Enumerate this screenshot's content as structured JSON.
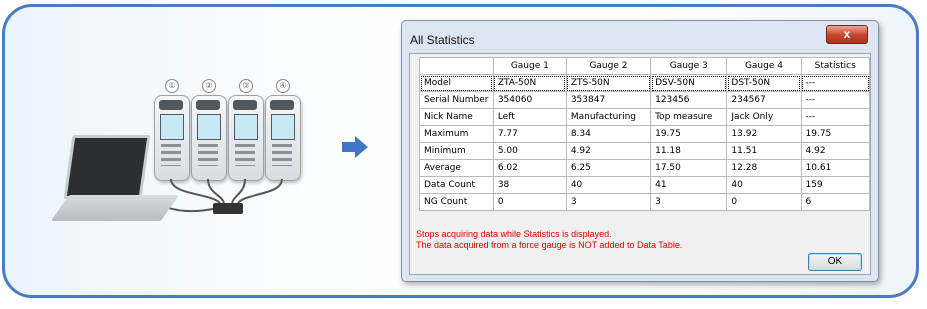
{
  "illustration": {
    "gauge_numbers": [
      "①",
      "②",
      "③",
      "④"
    ]
  },
  "dialog": {
    "title": "All Statistics",
    "close_label": "x",
    "table": {
      "headers": [
        "",
        "Gauge 1",
        "Gauge 2",
        "Gauge 3",
        "Gauge 4",
        "Statistics"
      ],
      "rows": [
        [
          "Model",
          "ZTA-50N",
          "ZTS-50N",
          "DSV-50N",
          "DST-50N",
          "---"
        ],
        [
          "Serial Number",
          "354060",
          "353847",
          "123456",
          "234567",
          "---"
        ],
        [
          "Nick Name",
          "Left",
          "Manufacturing",
          "Top measure",
          "Jack Only",
          "---"
        ],
        [
          "Maximum",
          "7.77",
          "8.34",
          "19.75",
          "13.92",
          "19.75"
        ],
        [
          "Minimum",
          "5.00",
          "4.92",
          "11.18",
          "11.51",
          "4.92"
        ],
        [
          "Average",
          "6.02",
          "6.25",
          "17.50",
          "12.28",
          "10.61"
        ],
        [
          "Data Count",
          "38",
          "40",
          "41",
          "40",
          "159"
        ],
        [
          "NG Count",
          "0",
          "3",
          "3",
          "0",
          "6"
        ]
      ]
    },
    "note_line1": "Stops acquiring data while Statistics is displayed.",
    "note_line2": "The data acquired from a force gauge is NOT added to Data Table.",
    "ok_label": "OK"
  },
  "colors": {
    "frame_border": "#4a7cc2",
    "arrow": "#3d78c4",
    "note_text": "#e00000"
  },
  "icons": [
    "arrow-right-icon",
    "close-icon",
    "laptop-icon",
    "force-gauge-icon",
    "usb-hub-icon"
  ]
}
